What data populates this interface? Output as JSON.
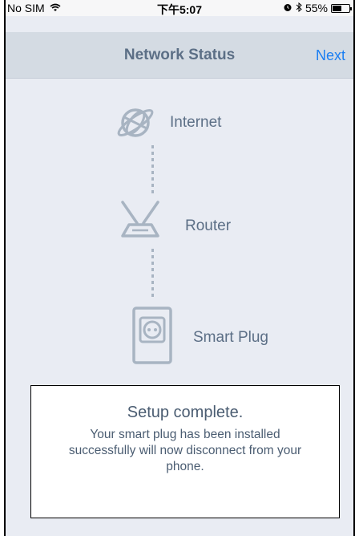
{
  "status_bar": {
    "carrier": "No SIM",
    "time": "下午5:07",
    "battery": "55%",
    "wifi_icon": "wifi-icon",
    "alarm_icon": "alarm-icon",
    "bluetooth_icon": "bluetooth-icon",
    "battery_icon": "battery-icon"
  },
  "nav": {
    "title": "Network Status",
    "next_label": "Next"
  },
  "nodes": {
    "internet_label": "Internet",
    "router_label": "Router",
    "plug_label": "Smart Plug"
  },
  "message": {
    "title": "Setup complete.",
    "line1": "Your smart plug has been installed",
    "line2": "successfully will now disconnect from your",
    "line3": "phone."
  },
  "colors": {
    "accent": "#1a7ef2",
    "label": "#5c6f86",
    "icon": "#a8b4c2",
    "background": "#e9ecf3",
    "navbar": "#d4dbe3"
  }
}
